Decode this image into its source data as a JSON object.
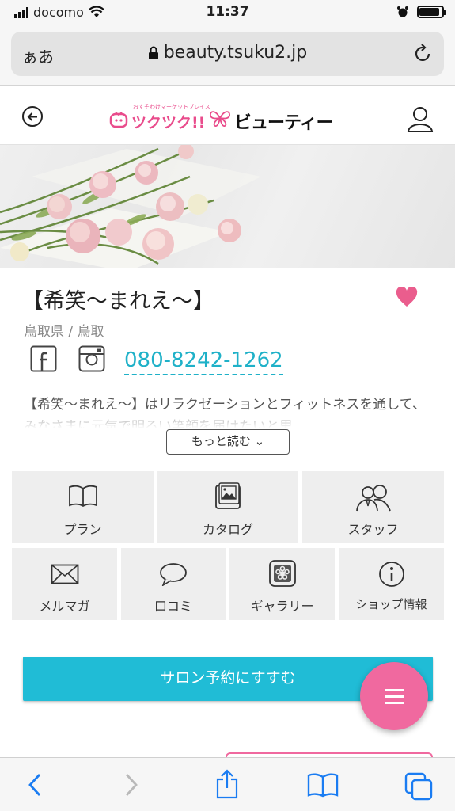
{
  "status_bar": {
    "carrier": "docomo",
    "time": "11:37",
    "battery_level": 0.9
  },
  "browser": {
    "text_size_label": "ぁあ",
    "url": "beauty.tsuku2.jp"
  },
  "site_header": {
    "logo_tagline": "おすそわけマーケットプレイス",
    "logo_brand": "ツクツク!!",
    "logo_sub": "ビューティー"
  },
  "salon": {
    "name": "【希笑〜まれえ〜】",
    "area": "鳥取県 / 鳥取",
    "phone": "080-8242-1262",
    "description": "【希笑〜まれえ〜】はリラクゼーションとフィットネスを通して、みなさまに元気で明るい笑顔を届けたいと思",
    "more_label": "もっと読む ⌄"
  },
  "menu": {
    "row1": [
      {
        "label": "プラン",
        "icon": "book-icon"
      },
      {
        "label": "カタログ",
        "icon": "catalog-icon"
      },
      {
        "label": "スタッフ",
        "icon": "staff-icon"
      }
    ],
    "row2": [
      {
        "label": "メルマガ",
        "icon": "mail-icon"
      },
      {
        "label": "口コミ",
        "icon": "speech-bubble-icon"
      },
      {
        "label": "ギャラリー",
        "icon": "gallery-icon"
      },
      {
        "label": "ショップ情報",
        "icon": "info-icon"
      }
    ]
  },
  "reserve_label": "サロン予約にすすむ",
  "colors": {
    "accent": "#20bcd6",
    "pink": "#f0699f",
    "ios_blue": "#1a7cf2"
  }
}
